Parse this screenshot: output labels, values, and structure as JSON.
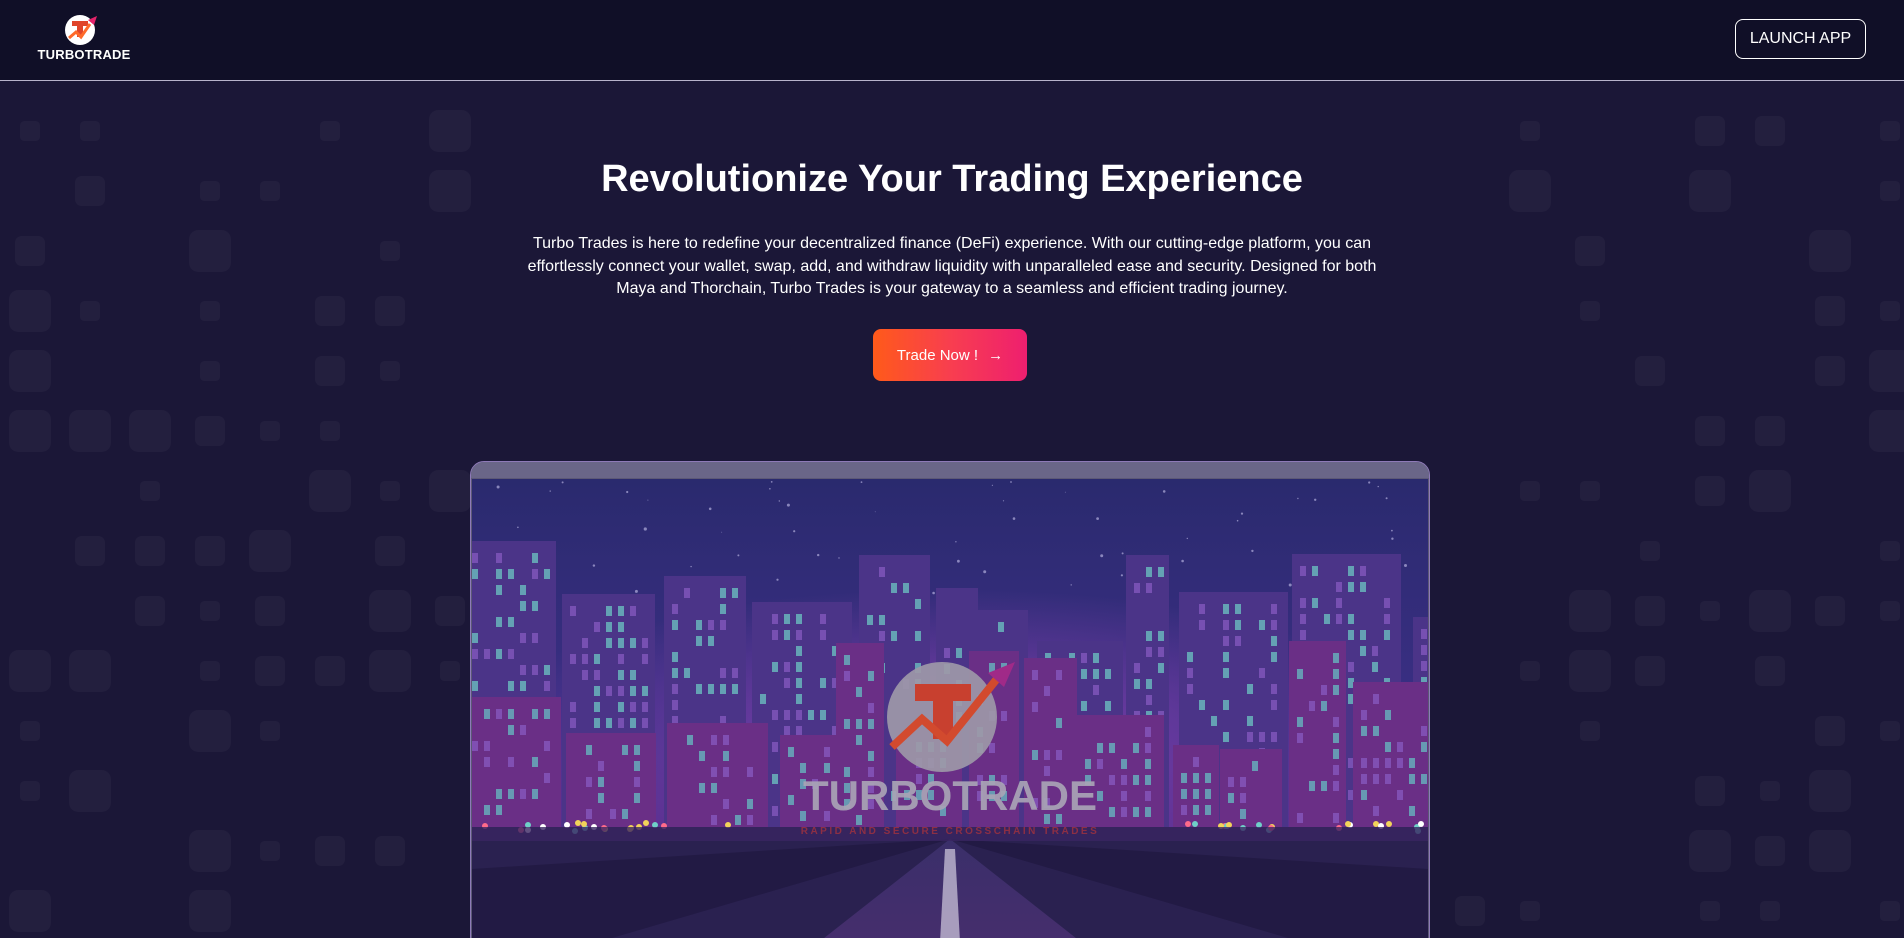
{
  "header": {
    "logo_text": "TURBOTRADE",
    "launch_label": "LAUNCH APP"
  },
  "hero": {
    "title": "Revolutionize Your Trading Experience",
    "description": "Turbo Trades is here to redefine your decentralized finance (DeFi) experience. With our cutting-edge platform, you can effortlessly connect your wallet, swap, add, and withdraw liquidity with unparalleled ease and security. Designed for both Maya and Thorchain, Turbo Trades is your gateway to a seamless and efficient trading journey.",
    "cta_label": "Trade Now !",
    "cta_icon": "arrow-right-icon"
  },
  "preview": {
    "brand_name": "TURBOTRADE",
    "brand_tagline": "RAPID AND SECURE CROSSCHAIN TRADES"
  },
  "colors": {
    "background": "#1b1737",
    "header": "#100f27",
    "cta_gradient_start": "#ff5a1a",
    "cta_gradient_end": "#ee1f6f",
    "brand_red": "#c8402f"
  }
}
